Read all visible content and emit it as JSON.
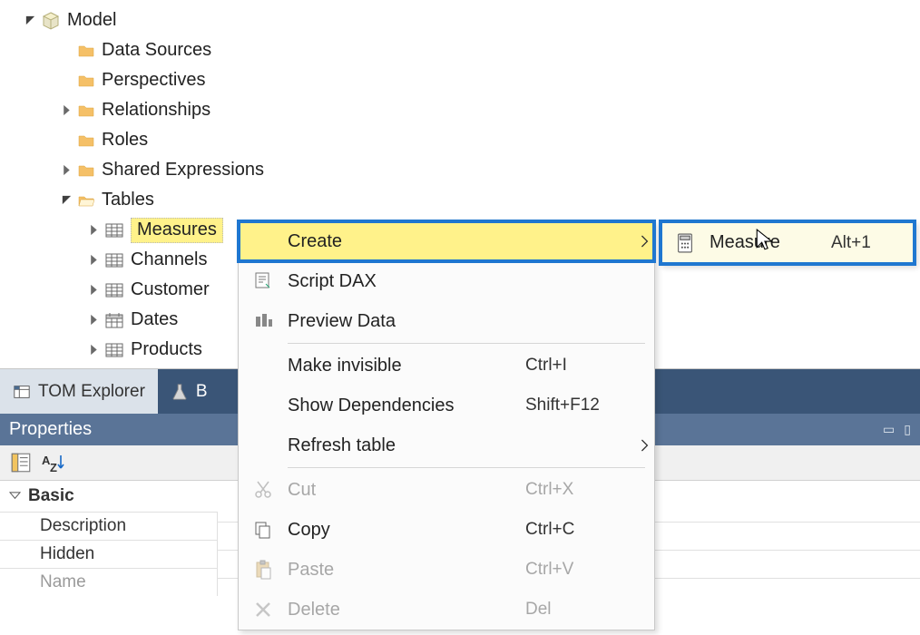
{
  "tree": {
    "root": "Model",
    "items": [
      {
        "label": "Data Sources",
        "icon": "folder",
        "indent": 2,
        "expandable": false
      },
      {
        "label": "Perspectives",
        "icon": "folder",
        "indent": 2,
        "expandable": false
      },
      {
        "label": "Relationships",
        "icon": "folder",
        "indent": 2,
        "expandable": true
      },
      {
        "label": "Roles",
        "icon": "folder",
        "indent": 2,
        "expandable": false
      },
      {
        "label": "Shared Expressions",
        "icon": "folder",
        "indent": 2,
        "expandable": true
      },
      {
        "label": "Tables",
        "icon": "folder-open",
        "indent": 2,
        "expanded": true
      }
    ],
    "tables": [
      {
        "label": "Measures",
        "icon": "table",
        "selected": true
      },
      {
        "label": "Channels",
        "icon": "table"
      },
      {
        "label": "Customer",
        "icon": "table"
      },
      {
        "label": "Dates",
        "icon": "date-table"
      },
      {
        "label": "Products",
        "icon": "table"
      }
    ]
  },
  "tabs": {
    "inactive": "TOM Explorer",
    "active_prefix": "B"
  },
  "properties": {
    "title": "Properties",
    "group": "Basic",
    "rows": [
      {
        "label": "Description",
        "value": ""
      },
      {
        "label": "Hidden",
        "value": ""
      },
      {
        "label": "Name",
        "value": "",
        "disabled": true
      }
    ]
  },
  "menu": {
    "items": [
      {
        "label": "Create",
        "submenu": true,
        "highlighted": true
      },
      {
        "label": "Script DAX",
        "icon": "script"
      },
      {
        "label": "Preview Data",
        "icon": "preview"
      },
      {
        "sep": true
      },
      {
        "label": "Make invisible",
        "shortcut": "Ctrl+I"
      },
      {
        "label": "Show Dependencies",
        "shortcut": "Shift+F12"
      },
      {
        "label": "Refresh table",
        "submenu": true
      },
      {
        "sep": true
      },
      {
        "label": "Cut",
        "shortcut": "Ctrl+X",
        "icon": "cut",
        "disabled": true
      },
      {
        "label": "Copy",
        "shortcut": "Ctrl+C",
        "icon": "copy"
      },
      {
        "label": "Paste",
        "shortcut": "Ctrl+V",
        "icon": "paste",
        "disabled": true
      },
      {
        "label": "Delete",
        "shortcut": "Del",
        "icon": "delete",
        "disabled": true
      }
    ]
  },
  "submenu": {
    "label": "Measure",
    "shortcut": "Alt+1",
    "icon": "calculator"
  }
}
